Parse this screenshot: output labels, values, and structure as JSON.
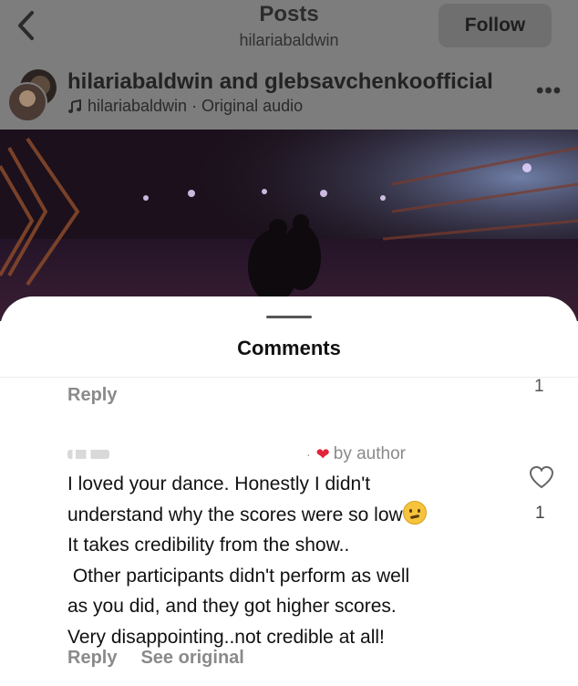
{
  "header": {
    "title": "Posts",
    "subtitle": "hilariabaldwin",
    "follow_label": "Follow"
  },
  "post": {
    "authors": "hilariabaldwin and glebsavchenkoofficial",
    "audio": "hilariabaldwin · Original audio"
  },
  "comments_sheet": {
    "title": "Comments",
    "previous_comment": {
      "reply_label": "Reply",
      "like_count": "1"
    },
    "comment": {
      "badge": "by author",
      "lines": [
        "I loved your dance. Honestly I didn't",
        "understand why the scores were so low",
        "It takes credibility from the show..",
        " Other participants didn't perform as well",
        "as you did, and they got higher scores.",
        "Very disappointing..not credible at all!"
      ],
      "like_count": "1",
      "reply_label": "Reply",
      "see_original_label": "See original"
    }
  },
  "colors": {
    "overlay_gray": "#7d7d7d",
    "secondary_text": "#8a8a8a",
    "heart_red": "#e0243a"
  },
  "icons": {
    "back": "chevron-left-icon",
    "audio": "music-note-icon",
    "more": "more-horizontal-icon",
    "like": "heart-outline-icon",
    "author_like": "heart-filled-icon",
    "emoji": "confused-face-emoji"
  }
}
